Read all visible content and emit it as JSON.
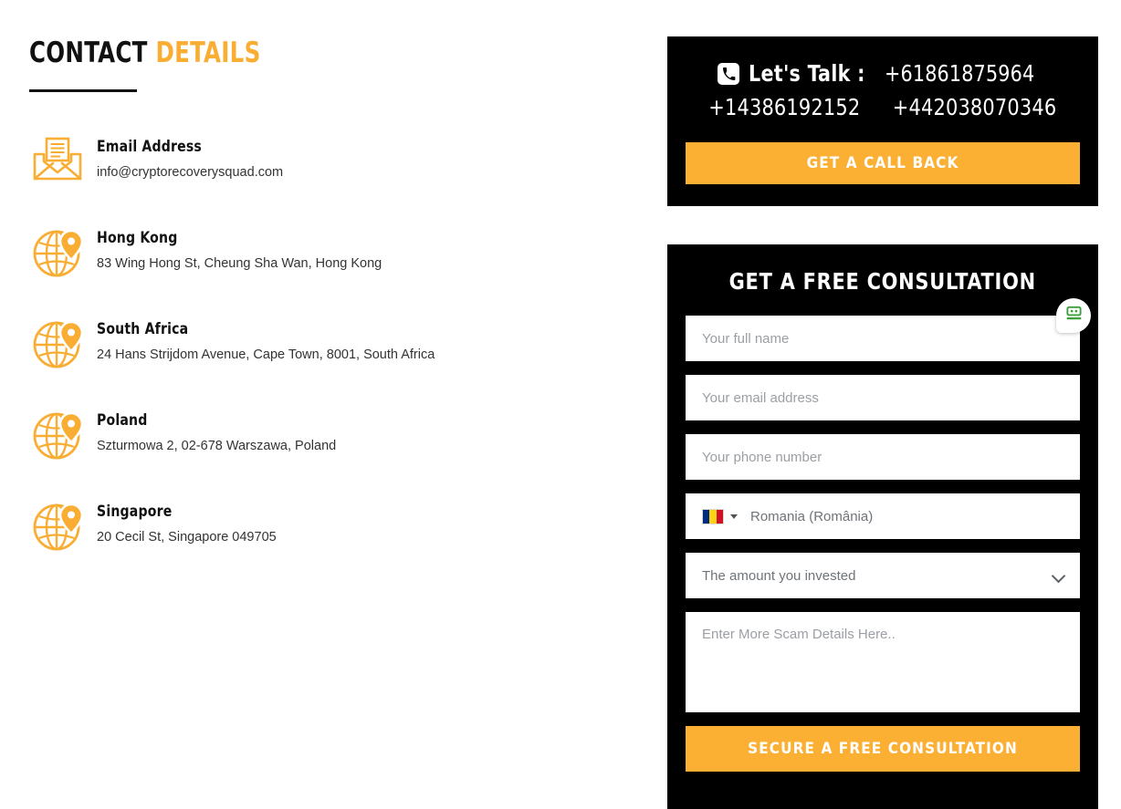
{
  "contact_section": {
    "title_primary": "CONTACT",
    "title_accent": "DETAILS",
    "items": [
      {
        "icon": "envelope-icon",
        "label": "Email Address",
        "value": "info@cryptorecoverysquad.com"
      },
      {
        "icon": "globe-pin-icon",
        "label": "Hong Kong",
        "value": "83 Wing Hong St, Cheung Sha Wan, Hong Kong"
      },
      {
        "icon": "globe-pin-icon",
        "label": "South Africa",
        "value": "24 Hans Strijdom Avenue, Cape Town, 8001, South Africa"
      },
      {
        "icon": "globe-pin-icon",
        "label": "Poland",
        "value": "Szturmowa 2, 02-678 Warszawa, Poland"
      },
      {
        "icon": "globe-pin-icon",
        "label": "Singapore",
        "value": "20 Cecil St, Singapore 049705"
      }
    ]
  },
  "talk_panel": {
    "icon": "phone-icon",
    "label": "Let's Talk :",
    "phone_primary": "+61861875964",
    "phone_secondary_1": "+14386192152",
    "phone_secondary_2": "+442038070346",
    "callback_button": "GET A CALL BACK"
  },
  "consultation_form": {
    "title": "GET A FREE CONSULTATION",
    "name_placeholder": "Your full name",
    "name_value": "",
    "email_placeholder": "Your email address",
    "email_value": "",
    "phone_placeholder": "Your phone number",
    "phone_value": "",
    "country_selected": "Romania (România)",
    "country_flag": "romania-flag-icon",
    "amount_selected": "The amount you invested",
    "amount_options": [
      "The amount you invested"
    ],
    "details_placeholder": "Enter More Scam Details Here..",
    "details_value": "",
    "submit_button": "SECURE A FREE CONSULTATION"
  },
  "chat_widget": {
    "icon": "robot-chat-icon"
  },
  "colors": {
    "accent_amber": "#fbb034",
    "icon_amber": "#f9ad32",
    "panel_black": "#000000",
    "text_dark": "#111111",
    "placeholder_gray": "#9b9fa4",
    "robot_green": "#4caf50"
  }
}
